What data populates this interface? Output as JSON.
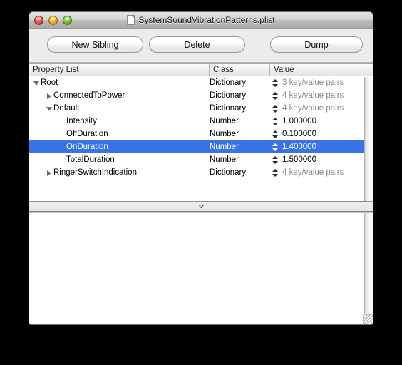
{
  "window": {
    "title": "SystemSoundVibrationPatterns.plist",
    "doc_icon": "document-icon",
    "traffic_lights": [
      {
        "name": "close",
        "color": "#f0584b"
      },
      {
        "name": "minimize",
        "color": "#f5b01f"
      },
      {
        "name": "zoom",
        "color": "#76c736"
      }
    ]
  },
  "toolbar": {
    "new_sibling_label": "New Sibling",
    "delete_label": "Delete",
    "dump_label": "Dump"
  },
  "outline": {
    "columns": [
      {
        "key": "property",
        "label": "Property List"
      },
      {
        "key": "class",
        "label": "Class"
      },
      {
        "key": "value",
        "label": "Value"
      }
    ],
    "selected_index": 5,
    "selection_color": "#3a72e8",
    "rows": [
      {
        "name": "Root",
        "depth": 0,
        "disclosure": "open",
        "class": "Dictionary",
        "value": "3 key/value pairs",
        "dim": true
      },
      {
        "name": "ConnectedToPower",
        "depth": 1,
        "disclosure": "closed",
        "class": "Dictionary",
        "value": "4 key/value pairs",
        "dim": true
      },
      {
        "name": "Default",
        "depth": 1,
        "disclosure": "open",
        "class": "Dictionary",
        "value": "4 key/value pairs",
        "dim": true
      },
      {
        "name": "Intensity",
        "depth": 2,
        "disclosure": "none",
        "class": "Number",
        "value": "1.000000",
        "dim": false
      },
      {
        "name": "OffDuration",
        "depth": 2,
        "disclosure": "none",
        "class": "Number",
        "value": "0.100000",
        "dim": false
      },
      {
        "name": "OnDuration",
        "depth": 2,
        "disclosure": "none",
        "class": "Number",
        "value": "1.400000",
        "dim": false
      },
      {
        "name": "TotalDuration",
        "depth": 2,
        "disclosure": "none",
        "class": "Number",
        "value": "1.500000",
        "dim": false
      },
      {
        "name": "RingerSwitchIndication",
        "depth": 1,
        "disclosure": "closed",
        "class": "Dictionary",
        "value": "4 key/value pairs",
        "dim": true
      }
    ]
  },
  "splitter": {
    "grip_icon": "grip-dots-icon"
  },
  "bottom_pane": {
    "content": ""
  }
}
